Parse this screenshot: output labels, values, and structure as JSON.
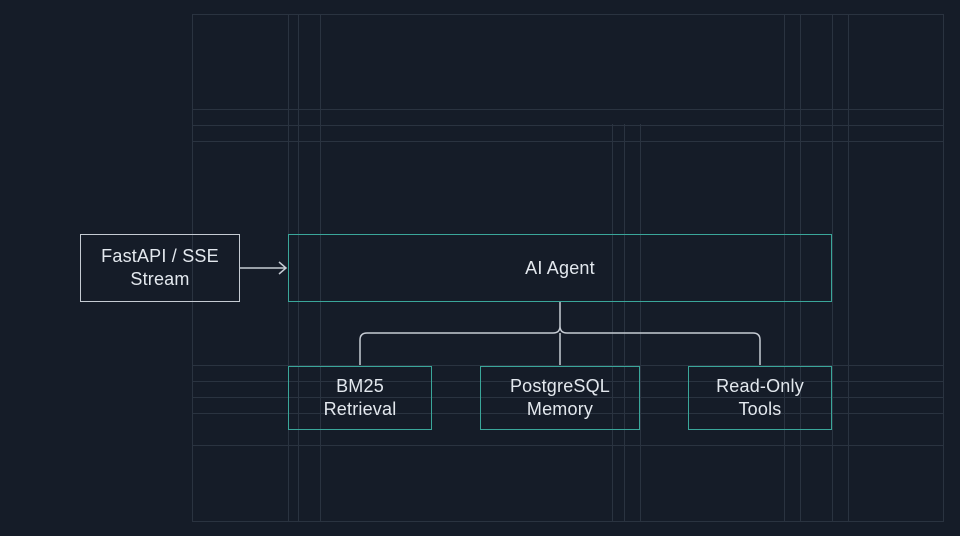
{
  "diagram": {
    "input_node": {
      "label": "FastAPI / SSE\nStream"
    },
    "agent_node": {
      "label": "AI Agent"
    },
    "components": [
      {
        "label": "BM25\nRetrieval"
      },
      {
        "label": "PostgreSQL\nMemory"
      },
      {
        "label": "Read-Only\nTools"
      }
    ],
    "edges": [
      {
        "from": "FastAPI / SSE Stream",
        "to": "AI Agent",
        "arrow": true
      },
      {
        "from": "AI Agent",
        "to": "BM25 Retrieval",
        "arrow": false
      },
      {
        "from": "AI Agent",
        "to": "PostgreSQL Memory",
        "arrow": false
      },
      {
        "from": "AI Agent",
        "to": "Read-Only Tools",
        "arrow": false
      }
    ],
    "colors": {
      "background": "#151c28",
      "grid_line": "#2a3340",
      "input_border": "#c5cbd3",
      "agent_border": "#3aa69a",
      "connector": "#c5cbd3",
      "text": "#e3e8ee"
    }
  }
}
